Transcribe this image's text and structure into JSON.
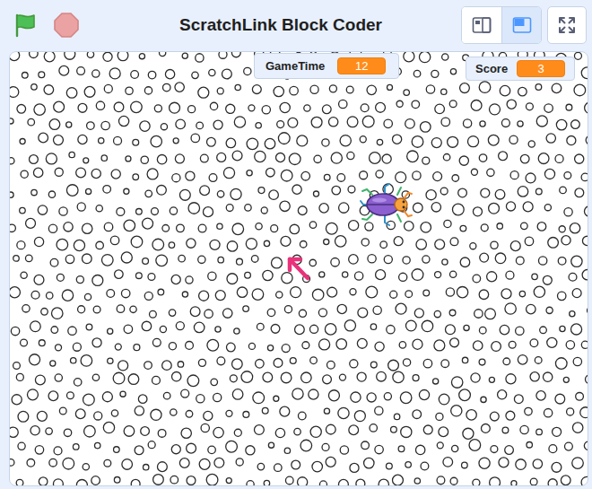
{
  "window": {
    "title": "ScratchLink Block Coder"
  },
  "toolbar": {
    "stage_modes": [
      {
        "selected": false
      },
      {
        "selected": true
      }
    ]
  },
  "monitors": [
    {
      "label": "GameTime",
      "value": "12"
    },
    {
      "label": "Score",
      "value": "3"
    }
  ],
  "sprites": [
    {
      "kind": "beetle"
    },
    {
      "kind": "arrow"
    }
  ]
}
